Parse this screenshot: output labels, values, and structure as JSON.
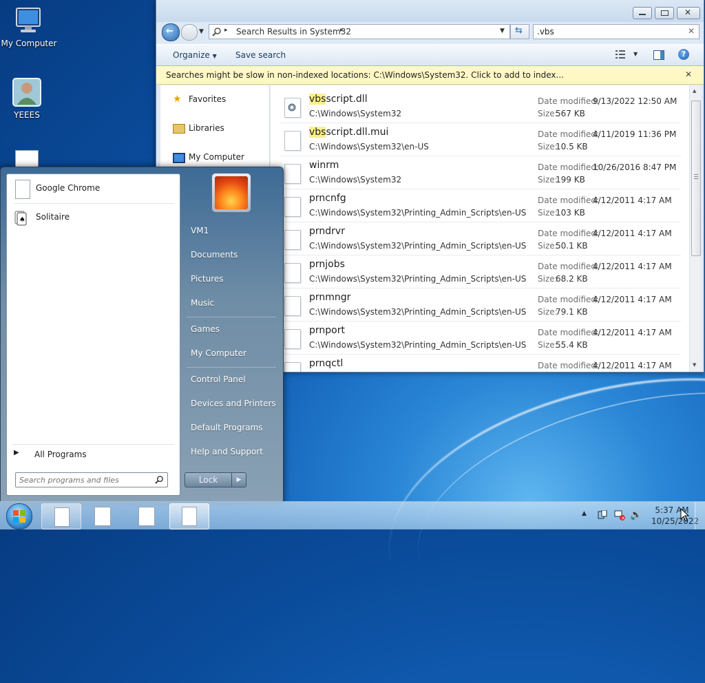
{
  "desktop": {
    "icons": [
      {
        "label": "My Computer"
      },
      {
        "label": "YEEES"
      }
    ]
  },
  "explorer": {
    "address": {
      "parts": [
        "Search Results in System32"
      ]
    },
    "search": {
      "value": ".vbs"
    },
    "toolbar": {
      "organize": "Organize",
      "save_search": "Save search"
    },
    "infobar": "Searches might be slow in non-indexed locations: C:\\Windows\\System32. Click to add to index...",
    "nav": [
      "Favorites",
      "Libraries",
      "My Computer"
    ],
    "labels": {
      "date_modified": "Date modified:",
      "size": "Size:"
    },
    "results": [
      {
        "hl": "vbs",
        "rest": "script.dll",
        "path": "C:\\Windows\\System32",
        "date": "9/13/2022 12:50 AM",
        "size": "567 KB"
      },
      {
        "hl": "vbs",
        "rest": "script.dll.mui",
        "path": "C:\\Windows\\System32\\en-US",
        "date": "4/11/2019 11:36 PM",
        "size": "10.5 KB"
      },
      {
        "hl": "",
        "rest": "winrm",
        "path": "C:\\Windows\\System32",
        "date": "10/26/2016 8:47 PM",
        "size": "199 KB"
      },
      {
        "hl": "",
        "rest": "prncnfg",
        "path": "C:\\Windows\\System32\\Printing_Admin_Scripts\\en-US",
        "date": "4/12/2011 4:17 AM",
        "size": "103 KB"
      },
      {
        "hl": "",
        "rest": "prndrvr",
        "path": "C:\\Windows\\System32\\Printing_Admin_Scripts\\en-US",
        "date": "4/12/2011 4:17 AM",
        "size": "50.1 KB"
      },
      {
        "hl": "",
        "rest": "prnjobs",
        "path": "C:\\Windows\\System32\\Printing_Admin_Scripts\\en-US",
        "date": "4/12/2011 4:17 AM",
        "size": "68.2 KB"
      },
      {
        "hl": "",
        "rest": "prnmngr",
        "path": "C:\\Windows\\System32\\Printing_Admin_Scripts\\en-US",
        "date": "4/12/2011 4:17 AM",
        "size": "79.1 KB"
      },
      {
        "hl": "",
        "rest": "prnport",
        "path": "C:\\Windows\\System32\\Printing_Admin_Scripts\\en-US",
        "date": "4/12/2011 4:17 AM",
        "size": "55.4 KB"
      },
      {
        "hl": "",
        "rest": "prnqctl",
        "path": "",
        "date": "4/12/2011 4:17 AM",
        "size": ""
      }
    ]
  },
  "start_menu": {
    "programs": [
      "Google Chrome",
      "Solitaire"
    ],
    "all_programs": "All Programs",
    "search_placeholder": "Search programs and files",
    "right_links": [
      "VM1",
      "Documents",
      "Pictures",
      "Music",
      "Games",
      "My Computer",
      "Control Panel",
      "Devices and Printers",
      "Default Programs",
      "Help and Support"
    ],
    "lock": "Lock"
  },
  "taskbar": {
    "time": "5:37 AM",
    "date": "10/25/2022"
  }
}
